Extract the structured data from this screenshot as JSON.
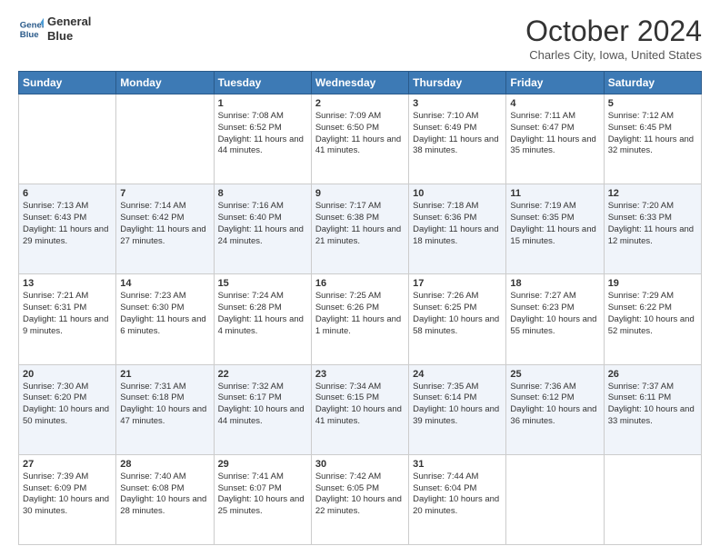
{
  "header": {
    "logo_line1": "General",
    "logo_line2": "Blue",
    "month": "October 2024",
    "location": "Charles City, Iowa, United States"
  },
  "weekdays": [
    "Sunday",
    "Monday",
    "Tuesday",
    "Wednesday",
    "Thursday",
    "Friday",
    "Saturday"
  ],
  "weeks": [
    [
      {
        "day": "",
        "info": ""
      },
      {
        "day": "",
        "info": ""
      },
      {
        "day": "1",
        "info": "Sunrise: 7:08 AM\nSunset: 6:52 PM\nDaylight: 11 hours and 44 minutes."
      },
      {
        "day": "2",
        "info": "Sunrise: 7:09 AM\nSunset: 6:50 PM\nDaylight: 11 hours and 41 minutes."
      },
      {
        "day": "3",
        "info": "Sunrise: 7:10 AM\nSunset: 6:49 PM\nDaylight: 11 hours and 38 minutes."
      },
      {
        "day": "4",
        "info": "Sunrise: 7:11 AM\nSunset: 6:47 PM\nDaylight: 11 hours and 35 minutes."
      },
      {
        "day": "5",
        "info": "Sunrise: 7:12 AM\nSunset: 6:45 PM\nDaylight: 11 hours and 32 minutes."
      }
    ],
    [
      {
        "day": "6",
        "info": "Sunrise: 7:13 AM\nSunset: 6:43 PM\nDaylight: 11 hours and 29 minutes."
      },
      {
        "day": "7",
        "info": "Sunrise: 7:14 AM\nSunset: 6:42 PM\nDaylight: 11 hours and 27 minutes."
      },
      {
        "day": "8",
        "info": "Sunrise: 7:16 AM\nSunset: 6:40 PM\nDaylight: 11 hours and 24 minutes."
      },
      {
        "day": "9",
        "info": "Sunrise: 7:17 AM\nSunset: 6:38 PM\nDaylight: 11 hours and 21 minutes."
      },
      {
        "day": "10",
        "info": "Sunrise: 7:18 AM\nSunset: 6:36 PM\nDaylight: 11 hours and 18 minutes."
      },
      {
        "day": "11",
        "info": "Sunrise: 7:19 AM\nSunset: 6:35 PM\nDaylight: 11 hours and 15 minutes."
      },
      {
        "day": "12",
        "info": "Sunrise: 7:20 AM\nSunset: 6:33 PM\nDaylight: 11 hours and 12 minutes."
      }
    ],
    [
      {
        "day": "13",
        "info": "Sunrise: 7:21 AM\nSunset: 6:31 PM\nDaylight: 11 hours and 9 minutes."
      },
      {
        "day": "14",
        "info": "Sunrise: 7:23 AM\nSunset: 6:30 PM\nDaylight: 11 hours and 6 minutes."
      },
      {
        "day": "15",
        "info": "Sunrise: 7:24 AM\nSunset: 6:28 PM\nDaylight: 11 hours and 4 minutes."
      },
      {
        "day": "16",
        "info": "Sunrise: 7:25 AM\nSunset: 6:26 PM\nDaylight: 11 hours and 1 minute."
      },
      {
        "day": "17",
        "info": "Sunrise: 7:26 AM\nSunset: 6:25 PM\nDaylight: 10 hours and 58 minutes."
      },
      {
        "day": "18",
        "info": "Sunrise: 7:27 AM\nSunset: 6:23 PM\nDaylight: 10 hours and 55 minutes."
      },
      {
        "day": "19",
        "info": "Sunrise: 7:29 AM\nSunset: 6:22 PM\nDaylight: 10 hours and 52 minutes."
      }
    ],
    [
      {
        "day": "20",
        "info": "Sunrise: 7:30 AM\nSunset: 6:20 PM\nDaylight: 10 hours and 50 minutes."
      },
      {
        "day": "21",
        "info": "Sunrise: 7:31 AM\nSunset: 6:18 PM\nDaylight: 10 hours and 47 minutes."
      },
      {
        "day": "22",
        "info": "Sunrise: 7:32 AM\nSunset: 6:17 PM\nDaylight: 10 hours and 44 minutes."
      },
      {
        "day": "23",
        "info": "Sunrise: 7:34 AM\nSunset: 6:15 PM\nDaylight: 10 hours and 41 minutes."
      },
      {
        "day": "24",
        "info": "Sunrise: 7:35 AM\nSunset: 6:14 PM\nDaylight: 10 hours and 39 minutes."
      },
      {
        "day": "25",
        "info": "Sunrise: 7:36 AM\nSunset: 6:12 PM\nDaylight: 10 hours and 36 minutes."
      },
      {
        "day": "26",
        "info": "Sunrise: 7:37 AM\nSunset: 6:11 PM\nDaylight: 10 hours and 33 minutes."
      }
    ],
    [
      {
        "day": "27",
        "info": "Sunrise: 7:39 AM\nSunset: 6:09 PM\nDaylight: 10 hours and 30 minutes."
      },
      {
        "day": "28",
        "info": "Sunrise: 7:40 AM\nSunset: 6:08 PM\nDaylight: 10 hours and 28 minutes."
      },
      {
        "day": "29",
        "info": "Sunrise: 7:41 AM\nSunset: 6:07 PM\nDaylight: 10 hours and 25 minutes."
      },
      {
        "day": "30",
        "info": "Sunrise: 7:42 AM\nSunset: 6:05 PM\nDaylight: 10 hours and 22 minutes."
      },
      {
        "day": "31",
        "info": "Sunrise: 7:44 AM\nSunset: 6:04 PM\nDaylight: 10 hours and 20 minutes."
      },
      {
        "day": "",
        "info": ""
      },
      {
        "day": "",
        "info": ""
      }
    ]
  ]
}
